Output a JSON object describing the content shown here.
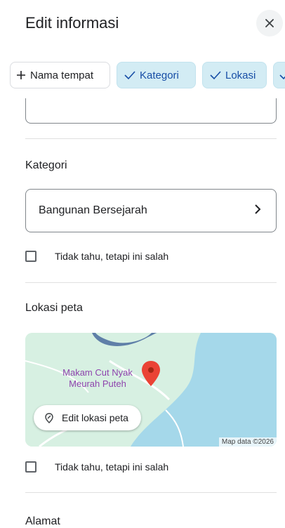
{
  "header": {
    "title": "Edit informasi"
  },
  "chips": [
    {
      "label": "Nama tempat",
      "selected": false
    },
    {
      "label": "Kategori",
      "selected": true
    },
    {
      "label": "Lokasi",
      "selected": true
    }
  ],
  "category": {
    "title": "Kategori",
    "value": "Bangunan Bersejarah",
    "not_sure_label": "Tidak tahu, tetapi ini salah"
  },
  "map_section": {
    "title": "Lokasi peta",
    "place_label": "Makam Cut Nyak Meurah Puteh",
    "edit_button": "Edit lokasi peta",
    "credit": "Map data ©2026",
    "not_sure_label": "Tidak tahu, tetapi ini salah"
  },
  "address": {
    "title": "Alamat"
  },
  "colors": {
    "chip_selected_bg": "#d3ecf4",
    "pin": "#ea4335",
    "water": "#a5d8ea",
    "land": "#d7f0e2"
  }
}
